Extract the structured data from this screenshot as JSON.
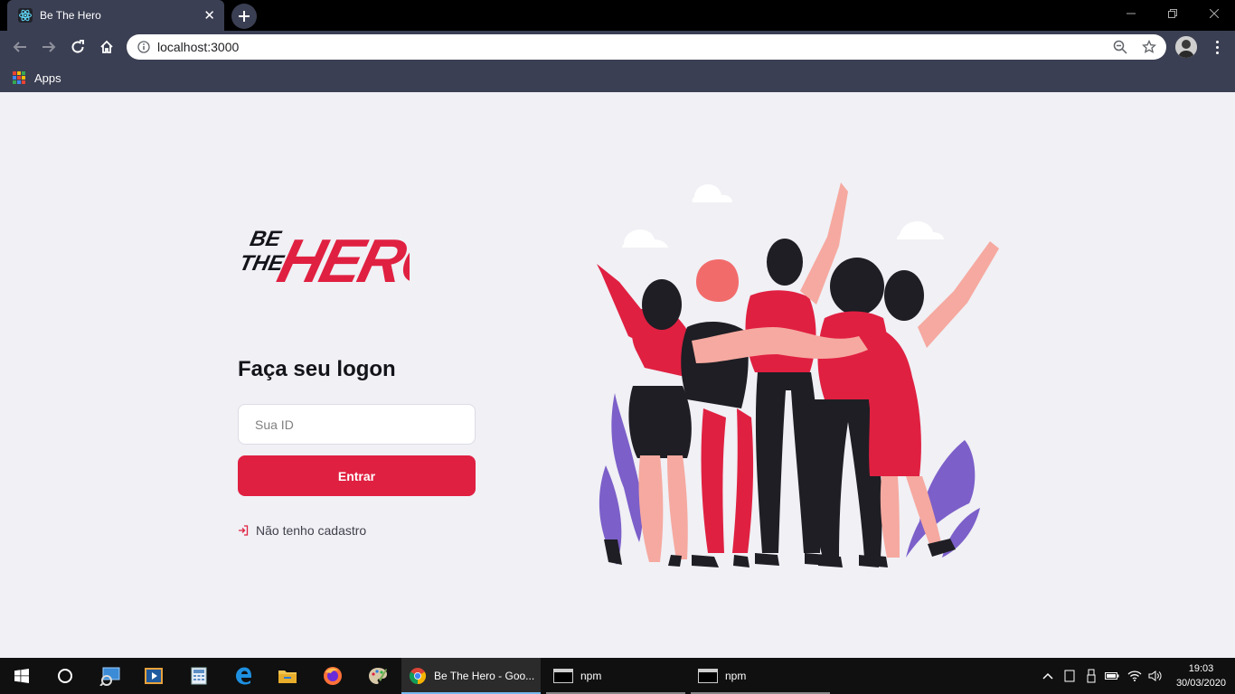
{
  "browser": {
    "tab_title": "Be The Hero",
    "tab_close": "✕",
    "url": "localhost:3000",
    "bookmarks_apps_label": "Apps"
  },
  "page": {
    "logo_text_small": "BE THE",
    "logo_text_large": "HERO",
    "logon_title": "Faça seu logon",
    "id_placeholder": "Sua ID",
    "enter_button": "Entrar",
    "register_link": "Não tenho cadastro"
  },
  "colors": {
    "accent": "#e02041",
    "background": "#f0f0f5",
    "chrome": "#3b3f53"
  },
  "taskbar": {
    "apps": [
      {
        "label": "Be The Hero - Goo...",
        "icon": "chrome-icon"
      },
      {
        "label": "npm",
        "icon": "terminal-icon"
      },
      {
        "label": "npm",
        "icon": "terminal-icon"
      }
    ],
    "time": "19:03",
    "date": "30/03/2020"
  }
}
